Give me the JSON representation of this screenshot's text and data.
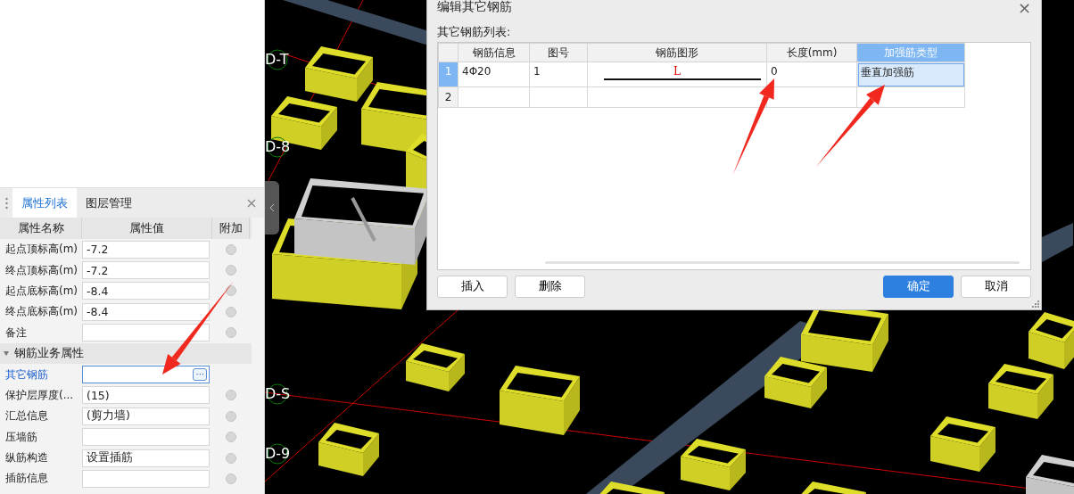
{
  "properties_panel": {
    "tabs": [
      {
        "label": "属性列表",
        "selected": true
      },
      {
        "label": "图层管理",
        "selected": false
      }
    ],
    "close": "×",
    "columns": [
      "属性名称",
      "属性值",
      "附加"
    ],
    "rows": [
      {
        "kind": "prop",
        "name": "起点顶标高(m)",
        "value": "-7.2",
        "selected": false,
        "checked": false
      },
      {
        "kind": "prop",
        "name": "终点顶标高(m)",
        "value": "-7.2",
        "selected": false,
        "checked": false
      },
      {
        "kind": "prop",
        "name": "起点底标高(m)",
        "value": "-8.4",
        "selected": false,
        "checked": false
      },
      {
        "kind": "prop",
        "name": "终点底标高(m)",
        "value": "-8.4",
        "selected": false,
        "checked": false
      },
      {
        "kind": "prop",
        "name": "备注",
        "value": "",
        "selected": false,
        "checked": false
      },
      {
        "kind": "group",
        "name": "钢筋业务属性",
        "expanded": true
      },
      {
        "kind": "prop",
        "name": "其它钢筋",
        "value": "",
        "selected": true,
        "button": "···"
      },
      {
        "kind": "prop",
        "name": "保护层厚度(...",
        "value": "(15)",
        "selected": false,
        "checked": false
      },
      {
        "kind": "prop",
        "name": "汇总信息",
        "value": "(剪力墙)",
        "selected": false,
        "checked": false
      },
      {
        "kind": "prop",
        "name": "压墙筋",
        "value": "",
        "selected": false,
        "checked": false
      },
      {
        "kind": "prop",
        "name": "纵筋构造",
        "value": "设置插筋",
        "selected": false,
        "checked": false
      },
      {
        "kind": "prop",
        "name": "插筋信息",
        "value": "",
        "selected": false,
        "checked": false
      }
    ]
  },
  "canvas": {
    "axis_labels": [
      "D-T",
      "D-8",
      "D-S",
      "D-9"
    ]
  },
  "dialog": {
    "title": "编辑其它钢筋",
    "close": "×",
    "list_label": "其它钢筋列表:",
    "table": {
      "columns": [
        {
          "label": "钢筋信息",
          "selected": false
        },
        {
          "label": "图号",
          "selected": false
        },
        {
          "label": "钢筋图形",
          "selected": false
        },
        {
          "label": "长度(mm)",
          "selected": false
        },
        {
          "label": "加强筋类型",
          "selected": true
        }
      ],
      "rows": [
        {
          "number": "1",
          "selected": true,
          "cells": [
            "4Φ20",
            "1",
            "L",
            "0",
            "垂直加强筋"
          ]
        },
        {
          "number": "2",
          "selected": false,
          "cells": [
            "",
            "",
            "",
            "",
            ""
          ]
        }
      ]
    },
    "buttons": [
      {
        "label": "插入",
        "kind": "normal"
      },
      {
        "label": "删除",
        "kind": "normal"
      },
      {
        "label": "确定",
        "kind": "primary"
      },
      {
        "label": "取消",
        "kind": "normal"
      }
    ]
  }
}
